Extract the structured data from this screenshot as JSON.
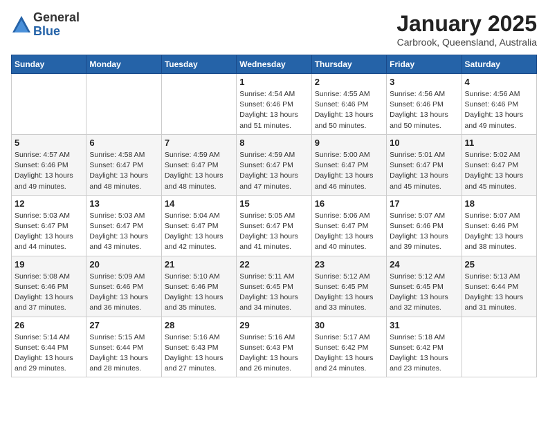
{
  "header": {
    "logo_general": "General",
    "logo_blue": "Blue",
    "month": "January 2025",
    "location": "Carbrook, Queensland, Australia"
  },
  "weekdays": [
    "Sunday",
    "Monday",
    "Tuesday",
    "Wednesday",
    "Thursday",
    "Friday",
    "Saturday"
  ],
  "weeks": [
    [
      {
        "day": "",
        "info": ""
      },
      {
        "day": "",
        "info": ""
      },
      {
        "day": "",
        "info": ""
      },
      {
        "day": "1",
        "info": "Sunrise: 4:54 AM\nSunset: 6:46 PM\nDaylight: 13 hours\nand 51 minutes."
      },
      {
        "day": "2",
        "info": "Sunrise: 4:55 AM\nSunset: 6:46 PM\nDaylight: 13 hours\nand 50 minutes."
      },
      {
        "day": "3",
        "info": "Sunrise: 4:56 AM\nSunset: 6:46 PM\nDaylight: 13 hours\nand 50 minutes."
      },
      {
        "day": "4",
        "info": "Sunrise: 4:56 AM\nSunset: 6:46 PM\nDaylight: 13 hours\nand 49 minutes."
      }
    ],
    [
      {
        "day": "5",
        "info": "Sunrise: 4:57 AM\nSunset: 6:46 PM\nDaylight: 13 hours\nand 49 minutes."
      },
      {
        "day": "6",
        "info": "Sunrise: 4:58 AM\nSunset: 6:47 PM\nDaylight: 13 hours\nand 48 minutes."
      },
      {
        "day": "7",
        "info": "Sunrise: 4:59 AM\nSunset: 6:47 PM\nDaylight: 13 hours\nand 48 minutes."
      },
      {
        "day": "8",
        "info": "Sunrise: 4:59 AM\nSunset: 6:47 PM\nDaylight: 13 hours\nand 47 minutes."
      },
      {
        "day": "9",
        "info": "Sunrise: 5:00 AM\nSunset: 6:47 PM\nDaylight: 13 hours\nand 46 minutes."
      },
      {
        "day": "10",
        "info": "Sunrise: 5:01 AM\nSunset: 6:47 PM\nDaylight: 13 hours\nand 45 minutes."
      },
      {
        "day": "11",
        "info": "Sunrise: 5:02 AM\nSunset: 6:47 PM\nDaylight: 13 hours\nand 45 minutes."
      }
    ],
    [
      {
        "day": "12",
        "info": "Sunrise: 5:03 AM\nSunset: 6:47 PM\nDaylight: 13 hours\nand 44 minutes."
      },
      {
        "day": "13",
        "info": "Sunrise: 5:03 AM\nSunset: 6:47 PM\nDaylight: 13 hours\nand 43 minutes."
      },
      {
        "day": "14",
        "info": "Sunrise: 5:04 AM\nSunset: 6:47 PM\nDaylight: 13 hours\nand 42 minutes."
      },
      {
        "day": "15",
        "info": "Sunrise: 5:05 AM\nSunset: 6:47 PM\nDaylight: 13 hours\nand 41 minutes."
      },
      {
        "day": "16",
        "info": "Sunrise: 5:06 AM\nSunset: 6:47 PM\nDaylight: 13 hours\nand 40 minutes."
      },
      {
        "day": "17",
        "info": "Sunrise: 5:07 AM\nSunset: 6:46 PM\nDaylight: 13 hours\nand 39 minutes."
      },
      {
        "day": "18",
        "info": "Sunrise: 5:07 AM\nSunset: 6:46 PM\nDaylight: 13 hours\nand 38 minutes."
      }
    ],
    [
      {
        "day": "19",
        "info": "Sunrise: 5:08 AM\nSunset: 6:46 PM\nDaylight: 13 hours\nand 37 minutes."
      },
      {
        "day": "20",
        "info": "Sunrise: 5:09 AM\nSunset: 6:46 PM\nDaylight: 13 hours\nand 36 minutes."
      },
      {
        "day": "21",
        "info": "Sunrise: 5:10 AM\nSunset: 6:46 PM\nDaylight: 13 hours\nand 35 minutes."
      },
      {
        "day": "22",
        "info": "Sunrise: 5:11 AM\nSunset: 6:45 PM\nDaylight: 13 hours\nand 34 minutes."
      },
      {
        "day": "23",
        "info": "Sunrise: 5:12 AM\nSunset: 6:45 PM\nDaylight: 13 hours\nand 33 minutes."
      },
      {
        "day": "24",
        "info": "Sunrise: 5:12 AM\nSunset: 6:45 PM\nDaylight: 13 hours\nand 32 minutes."
      },
      {
        "day": "25",
        "info": "Sunrise: 5:13 AM\nSunset: 6:44 PM\nDaylight: 13 hours\nand 31 minutes."
      }
    ],
    [
      {
        "day": "26",
        "info": "Sunrise: 5:14 AM\nSunset: 6:44 PM\nDaylight: 13 hours\nand 29 minutes."
      },
      {
        "day": "27",
        "info": "Sunrise: 5:15 AM\nSunset: 6:44 PM\nDaylight: 13 hours\nand 28 minutes."
      },
      {
        "day": "28",
        "info": "Sunrise: 5:16 AM\nSunset: 6:43 PM\nDaylight: 13 hours\nand 27 minutes."
      },
      {
        "day": "29",
        "info": "Sunrise: 5:16 AM\nSunset: 6:43 PM\nDaylight: 13 hours\nand 26 minutes."
      },
      {
        "day": "30",
        "info": "Sunrise: 5:17 AM\nSunset: 6:42 PM\nDaylight: 13 hours\nand 24 minutes."
      },
      {
        "day": "31",
        "info": "Sunrise: 5:18 AM\nSunset: 6:42 PM\nDaylight: 13 hours\nand 23 minutes."
      },
      {
        "day": "",
        "info": ""
      }
    ]
  ]
}
